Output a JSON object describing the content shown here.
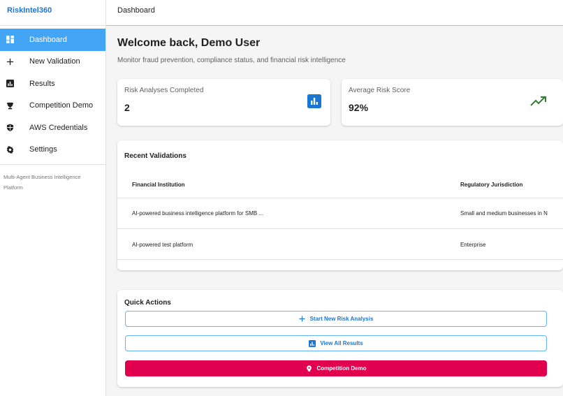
{
  "app": {
    "brand": "RiskIntel360"
  },
  "sidebar": {
    "items": [
      {
        "label": "Dashboard",
        "icon": "dashboard-icon",
        "active": true
      },
      {
        "label": "New Validation",
        "icon": "plus-icon",
        "active": false
      },
      {
        "label": "Results",
        "icon": "bar-chart-icon",
        "active": false
      },
      {
        "label": "Competition Demo",
        "icon": "trophy-icon",
        "active": false
      },
      {
        "label": "AWS Credentials",
        "icon": "shield-icon",
        "active": false
      },
      {
        "label": "Settings",
        "icon": "gear-icon",
        "active": false
      }
    ],
    "tagline": "Multi-Agent Business Intelligence Platform"
  },
  "topbar": {
    "title": "Dashboard"
  },
  "main": {
    "welcome": "Welcome back, Demo User",
    "subtitle": "Monitor fraud prevention, compliance status, and financial risk intelligence",
    "stats": [
      {
        "label": "Risk Analyses Completed",
        "value": "2",
        "icon": "bar-chart-icon",
        "icon_color": "#1976d2"
      },
      {
        "label": "Average Risk Score",
        "value": "92%",
        "icon": "trending-up-icon",
        "icon_color": "#2e7d32"
      }
    ],
    "recent": {
      "title": "Recent Validations",
      "columns": [
        "Financial Institution",
        "Regulatory Jurisdiction"
      ],
      "rows": [
        [
          "AI-powered business intelligence platform for SMB ...",
          "Small and medium businesses in N"
        ],
        [
          "AI-powered test platform",
          "Enterprise"
        ]
      ]
    },
    "quick_actions": {
      "title": "Quick Actions",
      "buttons": [
        {
          "label": "Start New Risk Analysis",
          "icon": "plus-icon"
        },
        {
          "label": "View All Results",
          "icon": "bar-chart-icon"
        },
        {
          "label": "Competition Demo",
          "icon": "lightbulb-icon"
        }
      ]
    }
  },
  "colors": {
    "primary": "#1976d2",
    "sidebar_active": "#42a5f5",
    "accent": "#e0004d",
    "success": "#2e7d32"
  }
}
